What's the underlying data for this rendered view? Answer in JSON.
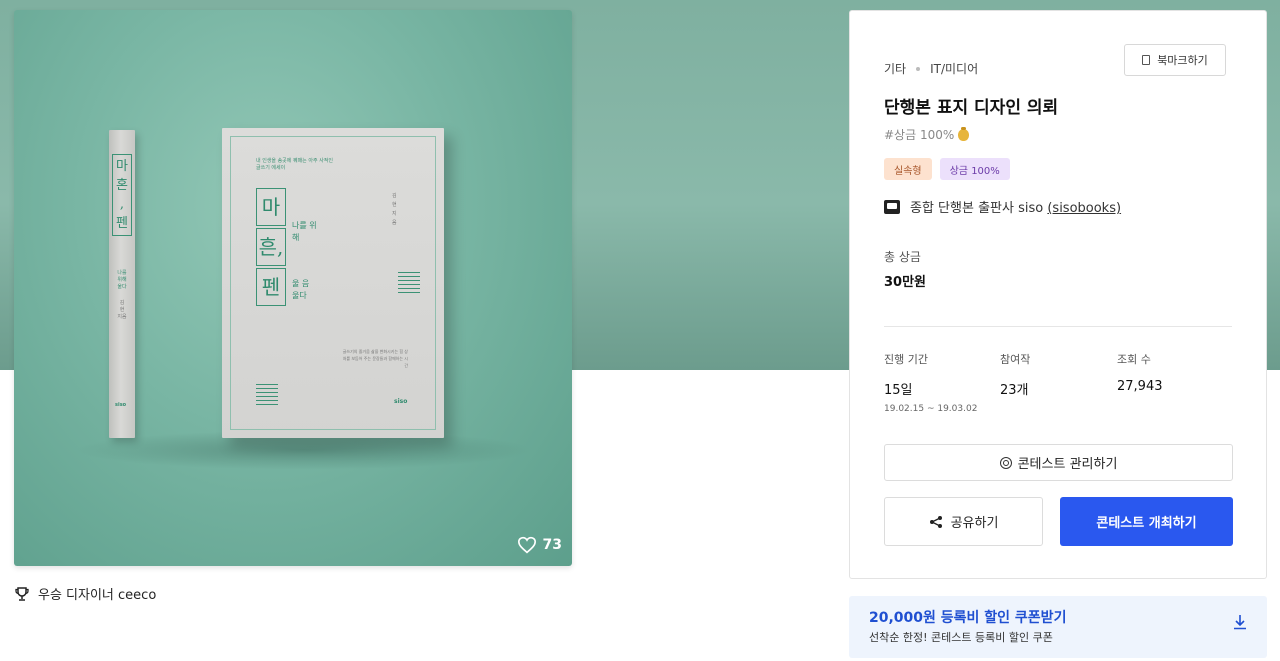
{
  "cover": {
    "likes_count": "73",
    "book": {
      "spine_title": "마 혼 , 펜",
      "spine_small": "나를 위해 울다",
      "spine_author": "김 현 지음",
      "spine_logo": "siso",
      "subtitle": "내 인생을 송곳에 꿰매는 아주 사적인 글쓰기 에세이",
      "title_line1": "마",
      "title_line2": "흔,",
      "title_line3": "펜",
      "side1": "나를 위해",
      "side2": "울 음 울다",
      "author": "김 현 지음",
      "blurb": "글쓰기의 즐거움 삶을 변화시키는 힘 상처를 보듬어 주는 문장들과 함께하는 시간",
      "logo": "siso"
    }
  },
  "winner": {
    "text": "우승 디자이너 ceeco"
  },
  "panel": {
    "category": "기타",
    "subcategory": "IT/미디어",
    "bookmark_label": "북마크하기",
    "title": "단행본 표지 디자인 의뢰",
    "hashtag": "#상금 100%",
    "tags": [
      "실속형",
      "상금 100%"
    ],
    "host_name": "종합 단행본 출판사 siso",
    "host_handle": "(sisobooks)",
    "prize_label": "총 상금",
    "prize_value": "30만원",
    "stats": {
      "period_label": "진행 기간",
      "period_value": "15일",
      "period_range": "19.02.15 ~ 19.03.02",
      "entries_label": "참여작",
      "entries_value": "23개",
      "views_label": "조회 수",
      "views_value": "27,943"
    },
    "manage_label": "콘테스트 관리하기",
    "share_label": "공유하기",
    "host_contest_label": "콘테스트 개최하기"
  },
  "coupon": {
    "title": "20,000원 등록비 할인 쿠폰받기",
    "subtitle": "선착순 한정! 콘테스트 등록비 할인 쿠폰"
  },
  "colors": {
    "primary": "#2a58ef",
    "hero_bg": "#86b5a6",
    "tag_orange_bg": "#fde2cf",
    "tag_purple_bg": "#ece0fb",
    "coupon_bg": "#eef4fd"
  }
}
